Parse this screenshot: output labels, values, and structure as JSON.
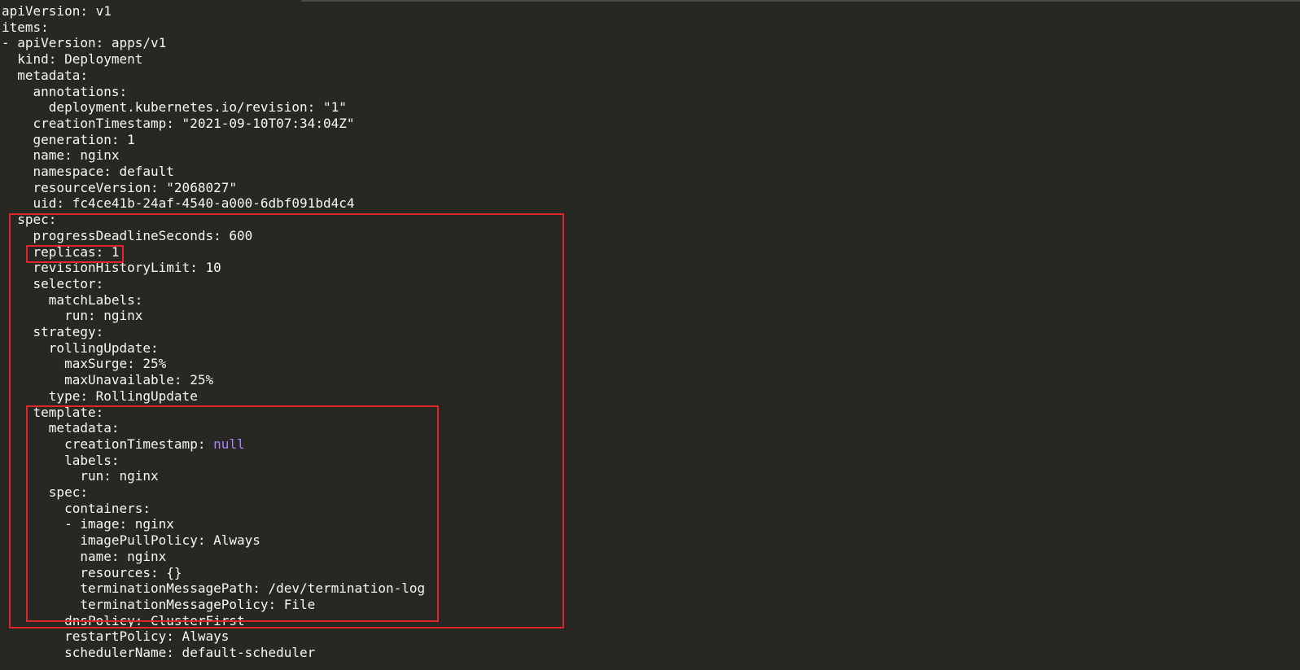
{
  "terminal": {
    "lines": [
      "apiVersion: v1",
      "items:",
      "- apiVersion: apps/v1",
      "  kind: Deployment",
      "  metadata:",
      "    annotations:",
      "      deployment.kubernetes.io/revision: \"1\"",
      "    creationTimestamp: \"2021-09-10T07:34:04Z\"",
      "    generation: 1",
      "    name: nginx",
      "    namespace: default",
      "    resourceVersion: \"2068027\"",
      "    uid: fc4ce41b-24af-4540-a000-6dbf091bd4c4",
      "  spec:",
      "    progressDeadlineSeconds: 600",
      "    replicas: 1",
      "    revisionHistoryLimit: 10",
      "    selector:",
      "      matchLabels:",
      "        run: nginx",
      "    strategy:",
      "      rollingUpdate:",
      "        maxSurge: 25%",
      "        maxUnavailable: 25%",
      "      type: RollingUpdate",
      "    template:",
      "      metadata:",
      "        creationTimestamp: ",
      "        labels:",
      "          run: nginx",
      "      spec:",
      "        containers:",
      "        - image: nginx",
      "          imagePullPolicy: Always",
      "          name: nginx",
      "          resources: {}",
      "          terminationMessagePath: /dev/termination-log",
      "          terminationMessagePolicy: File",
      "        dnsPolicy: ClusterFirst",
      "        restartPolicy: Always",
      "        schedulerName: default-scheduler"
    ],
    "null_token": "null"
  },
  "colors": {
    "background": "#272822",
    "text": "#f8f8f2",
    "keyword_null": "#ae81ff",
    "highlight_border": "#e0252e"
  }
}
